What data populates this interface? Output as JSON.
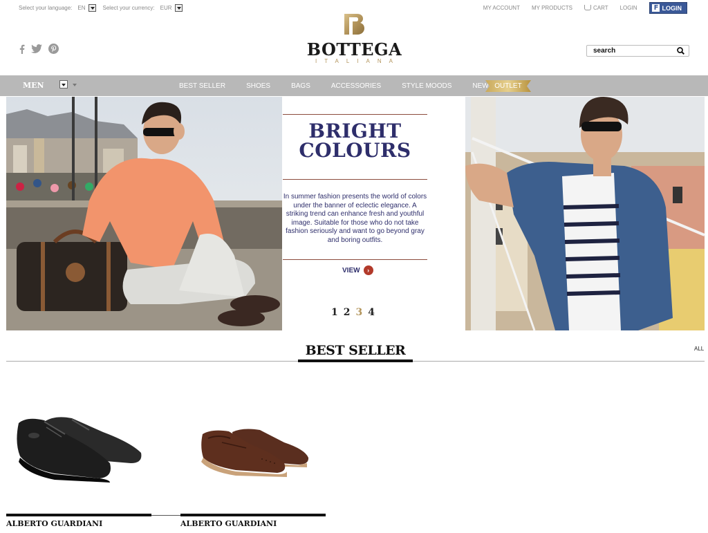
{
  "topbar": {
    "language_label": "Select your language:",
    "language_value": "EN",
    "currency_label": "Select your currency:",
    "currency_value": "EUR",
    "links": [
      "MY ACCOUNT",
      "MY PRODUCTS",
      "CART",
      "LOGIN"
    ],
    "fb_login": "Login"
  },
  "header": {
    "socials": [
      "facebook-icon",
      "twitter-icon",
      "pinterest-icon"
    ],
    "logo_text": "BOTTEGA",
    "logo_sub": "ITALIANA",
    "search_placeholder": "search"
  },
  "nav": {
    "gender": "MEN",
    "items": [
      "BEST SELLER",
      "SHOES",
      "BAGS",
      "ACCESSORIES",
      "STYLE MOODS",
      "NEWS"
    ],
    "outlet": "OUTLET"
  },
  "hero": {
    "title_line1": "BRIGHT",
    "title_line2": "COLOURS",
    "body": "In summer fashion presents the world of colors under the banner of eclectic elegance. A striking trend can enhance fresh and youthful image. Suitable for those who do not take fashion seriously and want to go beyond gray and boring outfits.",
    "view": "VIEW",
    "pages": [
      "1",
      "2",
      "3",
      "4"
    ],
    "active_page": "3"
  },
  "best_seller": {
    "title": "BEST SELLER",
    "all": "ALL",
    "products": [
      {
        "name": "ALBERTO GUARDIANI"
      },
      {
        "name": "ALBERTO GUARDIANI"
      }
    ]
  },
  "colors": {
    "nav_bg": "#b8b8b8",
    "hero_text": "#2e2e6b",
    "accent_gold": "#b3955c",
    "view_red": "#b23a2a",
    "facebook": "#3b5998"
  }
}
